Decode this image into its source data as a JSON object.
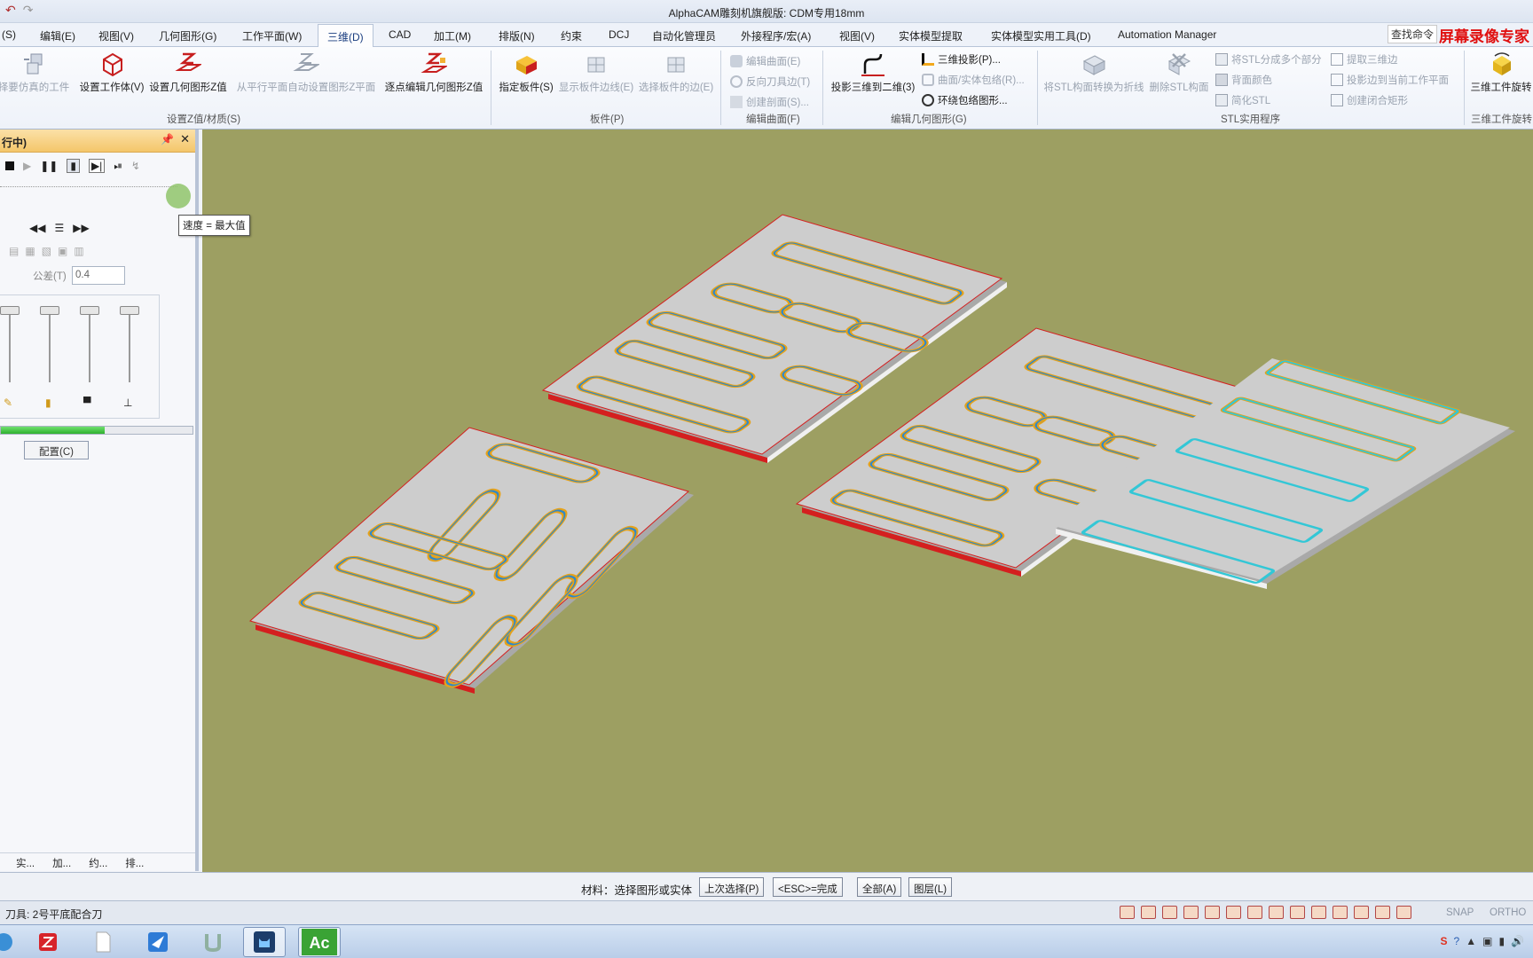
{
  "window": {
    "title": "AlphaCAM雕刻机旗舰版: CDM专用18mm"
  },
  "menu": {
    "tabs": [
      "(S)",
      "编辑(E)",
      "视图(V)",
      "几何图形(G)",
      "工作平面(W)",
      "三维(D)",
      "CAD",
      "加工(M)",
      "排版(N)",
      "约束",
      "DCJ",
      "自动化管理员",
      "外接程序/宏(A)",
      "视图(V)",
      "实体模型提取",
      "实体模型实用工具(D)",
      "Automation Manager"
    ],
    "active_tab": "三维(D)",
    "search_label": "查找命令",
    "watermark": "屏幕录像专家"
  },
  "ribbon": {
    "set_z": {
      "label": "设置Z值/材质(S)",
      "btn_sim_workpiece": "择要仿真的工件",
      "btn_set_workpiece": "设置工作体(V)",
      "btn_set_geo_z": "设置几何图形Z值",
      "btn_auto_plane_z": "从平行平面自动设置图形Z平面",
      "btn_point_edit_z": "逐点编辑几何图形Z值"
    },
    "sheets": {
      "label": "板件(P)",
      "btn_assign": "指定板件(S)",
      "btn_show_edges": "显示板件边线(E)",
      "btn_select_edges": "选择板件的边(E)"
    },
    "edit_surface": {
      "label": "编辑曲面(F)",
      "edit_surface": "编辑曲面(E)",
      "reverse_tool_side": "反向刀具边(T)",
      "create_section": "创建剖面(S)..."
    },
    "edit_geo": {
      "label": "编辑几何图形(G)",
      "btn_project": "投影三维到二维(3)",
      "proj_3d": "三维投影(P)...",
      "wrap_surface": "曲面/实体包络(R)...",
      "wrap_geo": "环绕包络图形..."
    },
    "stl": {
      "label": "STL实用程序",
      "btn_to_polyline": "将STL构面转换为折线",
      "btn_delete": "删除STL构面",
      "split_stl": "将STL分成多个部分",
      "back_color": "背面颜色",
      "simplify": "简化STL",
      "extract_3d": "提取三维边",
      "project_edges": "投影边到当前工作平面",
      "create_rect": "创建闭合矩形"
    },
    "rotate": {
      "label": "三维工件旋转",
      "btn_rotate": "三维工件旋转"
    }
  },
  "left_panel": {
    "title": "行中)",
    "pin": "📌",
    "close": "✕",
    "tooltip": "速度 = 最大值",
    "tolerance_label": "公差(T)",
    "tolerance_value": "0.4",
    "progress": 0.54,
    "config_button": "配置(C)",
    "bottom_tabs": [
      "实...",
      "加...",
      "约...",
      "排..."
    ]
  },
  "command_bar": {
    "prompt": "材料：选择图形或实体",
    "btn_last": "上次选择(P)",
    "btn_done": "<ESC>=完成",
    "btn_all": "全部(A)",
    "btn_layer": "图层(L)"
  },
  "status": {
    "tool": "刀具: 2号平底配合刀",
    "snap": "SNAP",
    "ortho": "ORTHO"
  },
  "colors": {
    "viewport_bg": "#9d9f62",
    "sheet_fill": "#c9c9c9",
    "toolpath_orange": "#e6a21a",
    "toolpath_cyan": "#33c7d6",
    "outline_red": "#d41f1f"
  }
}
